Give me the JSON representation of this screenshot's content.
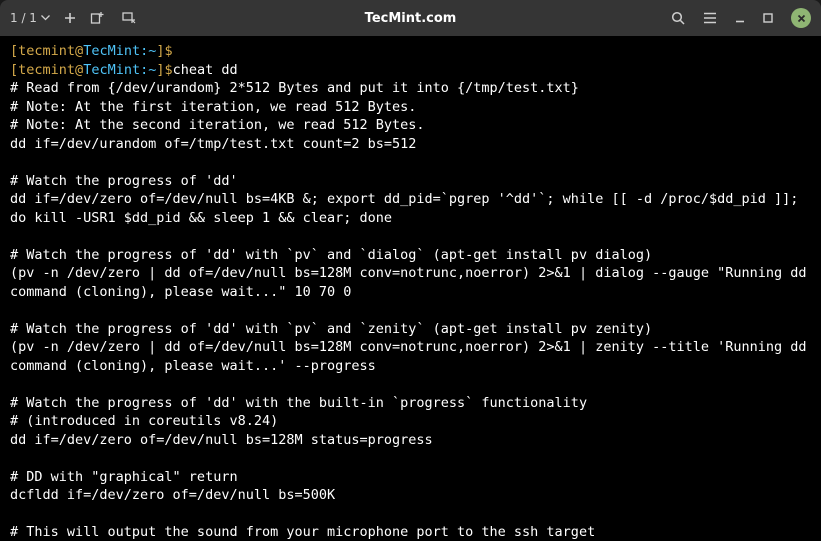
{
  "titlebar": {
    "tab_counter": "1 / 1",
    "title": "TecMint.com"
  },
  "prompt": {
    "open": "[",
    "user": "tecmint",
    "at": "@",
    "host": "TecMint",
    "colon": ":",
    "path": "~",
    "close": "]$"
  },
  "lines": {
    "cmd1": "",
    "cmd2": "cheat dd",
    "l0": "# Read from {/dev/urandom} 2*512 Bytes and put it into {/tmp/test.txt}",
    "l1": "# Note: At the first iteration, we read 512 Bytes.",
    "l2": "# Note: At the second iteration, we read 512 Bytes.",
    "l3": "dd if=/dev/urandom of=/tmp/test.txt count=2 bs=512",
    "l4": "",
    "l5": "# Watch the progress of 'dd'",
    "l6": "dd if=/dev/zero of=/dev/null bs=4KB &; export dd_pid=`pgrep '^dd'`; while [[ -d /proc/$dd_pid ]]; do kill -USR1 $dd_pid && sleep 1 && clear; done",
    "l7": "",
    "l8": "# Watch the progress of 'dd' with `pv` and `dialog` (apt-get install pv dialog)",
    "l9": "(pv -n /dev/zero | dd of=/dev/null bs=128M conv=notrunc,noerror) 2>&1 | dialog --gauge \"Running dd command (cloning), please wait...\" 10 70 0",
    "l10": "",
    "l11": "# Watch the progress of 'dd' with `pv` and `zenity` (apt-get install pv zenity)",
    "l12": "(pv -n /dev/zero | dd of=/dev/null bs=128M conv=notrunc,noerror) 2>&1 | zenity --title 'Running dd command (cloning), please wait...' --progress",
    "l13": "",
    "l14": "# Watch the progress of 'dd' with the built-in `progress` functionality",
    "l15": "# (introduced in coreutils v8.24)",
    "l16": "dd if=/dev/zero of=/dev/null bs=128M status=progress",
    "l17": "",
    "l18": "# DD with \"graphical\" return",
    "l19": "dcfldd if=/dev/zero of=/dev/null bs=500K",
    "l20": "",
    "l21": "# This will output the sound from your microphone port to the ssh target"
  }
}
